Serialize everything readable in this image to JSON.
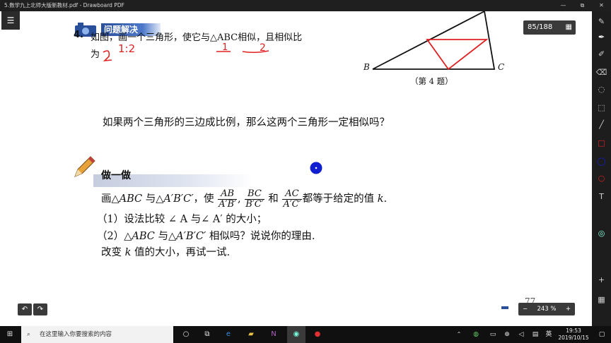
{
  "window": {
    "title": "5.数学九上北师大版新教材.pdf - Drawboard PDF",
    "minimize": "—",
    "maximize": "⧉",
    "close": "✕"
  },
  "toolbar": {
    "page_indicator": "85/188",
    "zoom_level": "243 %",
    "zoom_minus": "−",
    "zoom_plus": "+",
    "undo": "↶",
    "redo": "↷"
  },
  "document": {
    "section_title": "问题解决",
    "problem_number": "4.",
    "problem_text_line1": "如图，画一个三角形，使它与△ABC相似，且相似比",
    "problem_text_line2": "为",
    "handwriting_ratio": "1:2",
    "handwriting_one": "1",
    "handwriting_two": "2",
    "figure_label_B": "B",
    "figure_label_C": "C",
    "figure_caption": "（第 4 题）",
    "question": "如果两个三角形的三边成比例，那么这两个三角形一定相似吗？",
    "activity_title": "做一做",
    "activity_line1_a": "画△",
    "activity_line1_b": "ABC",
    "activity_line1_c": " 与△",
    "activity_line1_d": "A′B′C′",
    "activity_line1_e": "，使",
    "frac1_num": "AB",
    "frac1_den": "A′B′",
    "frac2_num": "BC",
    "frac2_den": "B′C′",
    "and": "和",
    "frac3_num": "AC",
    "frac3_den": "A′C′",
    "activity_line1_f": "都等于给定的值",
    "activity_line1_k": "k",
    "activity_line2": "（1）设法比较 ∠ A 与∠ A′ 的大小；",
    "activity_line3_a": "（2）△",
    "activity_line3_b": "ABC",
    "activity_line3_c": " 与△",
    "activity_line3_d": "A′B′C′",
    "activity_line3_e": " 相似吗？说说你的理由.",
    "activity_line4_a": "改变 ",
    "activity_line4_k": "k",
    "activity_line4_b": " 值的大小，再试一试.",
    "page_number": "77"
  },
  "taskbar": {
    "search_placeholder": "在这里输入你要搜索的内容",
    "ime": "英",
    "time": "19:53",
    "date": "2019/10/15"
  },
  "colors": {
    "annotation_red": "#e02020",
    "pen_blue": "#1020d0",
    "banner_blue": "#2a4f9a"
  }
}
